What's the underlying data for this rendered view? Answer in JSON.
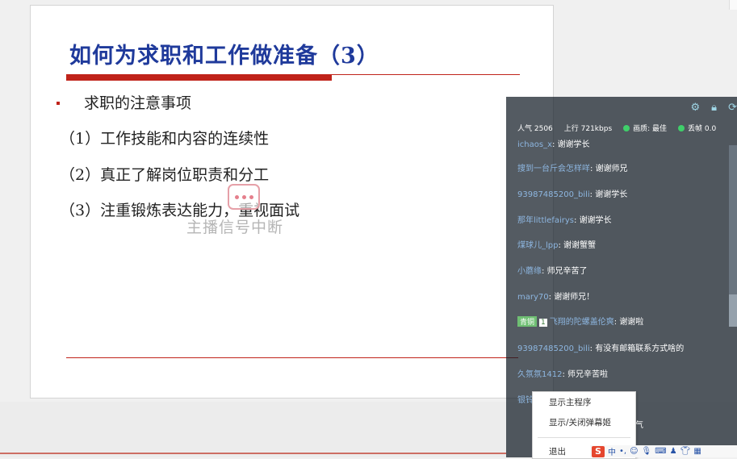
{
  "slide": {
    "title": "如何为求职和工作做准备（3）",
    "bullet_heading": "求职的注意事项",
    "items": [
      "（1）工作技能和内容的连续性",
      "（2）真正了解岗位职责和分工",
      "（3）注重锻炼表达能力，重视面试"
    ],
    "overlay_text": "主播信号中断"
  },
  "chat": {
    "stats": {
      "popularity": "人气 2506",
      "upload": "上行 721kbps",
      "quality": "画质: 最佳",
      "dropped": "丢帧 0.0"
    },
    "messages": [
      {
        "user": "ichaos_x",
        "text": "谢谢学长"
      },
      {
        "user": "搜到一台斤会怎样咩",
        "text": "谢谢师兄"
      },
      {
        "user": "93987485200_bili",
        "text": "谢谢学长"
      },
      {
        "user": "那年littlefairys",
        "text": "谢谢学长"
      },
      {
        "user": "煤球儿_lpp",
        "text": "谢谢蟹蟹"
      },
      {
        "user": "小蘑缘",
        "text": "师兄辛苦了"
      },
      {
        "user": "mary70",
        "text": "谢谢师兄！"
      },
      {
        "badge": "青铜",
        "level": "1",
        "user": "飞翔的陀螺盖伦爽",
        "text": "谢谢啦"
      },
      {
        "user": "93987485200_bili",
        "text": "有没有邮箱联系方式啥的"
      },
      {
        "user": "久氛氛1412",
        "text": "师兄辛苦啦"
      },
      {
        "user": "银铃",
        "text": ""
      }
    ],
    "footer_partial": "气"
  },
  "context_menu": {
    "items": [
      "显示主程序",
      "显示/关闭弹幕姬",
      "退出"
    ]
  },
  "ime": {
    "logo": "S",
    "mode": "中",
    "icons": [
      "punctuation-icon",
      "emoji-icon",
      "mic-icon",
      "keyboard-icon",
      "user-icon",
      "skin-icon",
      "grid-icon"
    ]
  },
  "colors": {
    "title_blue": "#1f3a9b",
    "accent_red": "#c0231a",
    "chat_user_blue": "#8db6e0",
    "status_green": "#3fcf6a"
  }
}
